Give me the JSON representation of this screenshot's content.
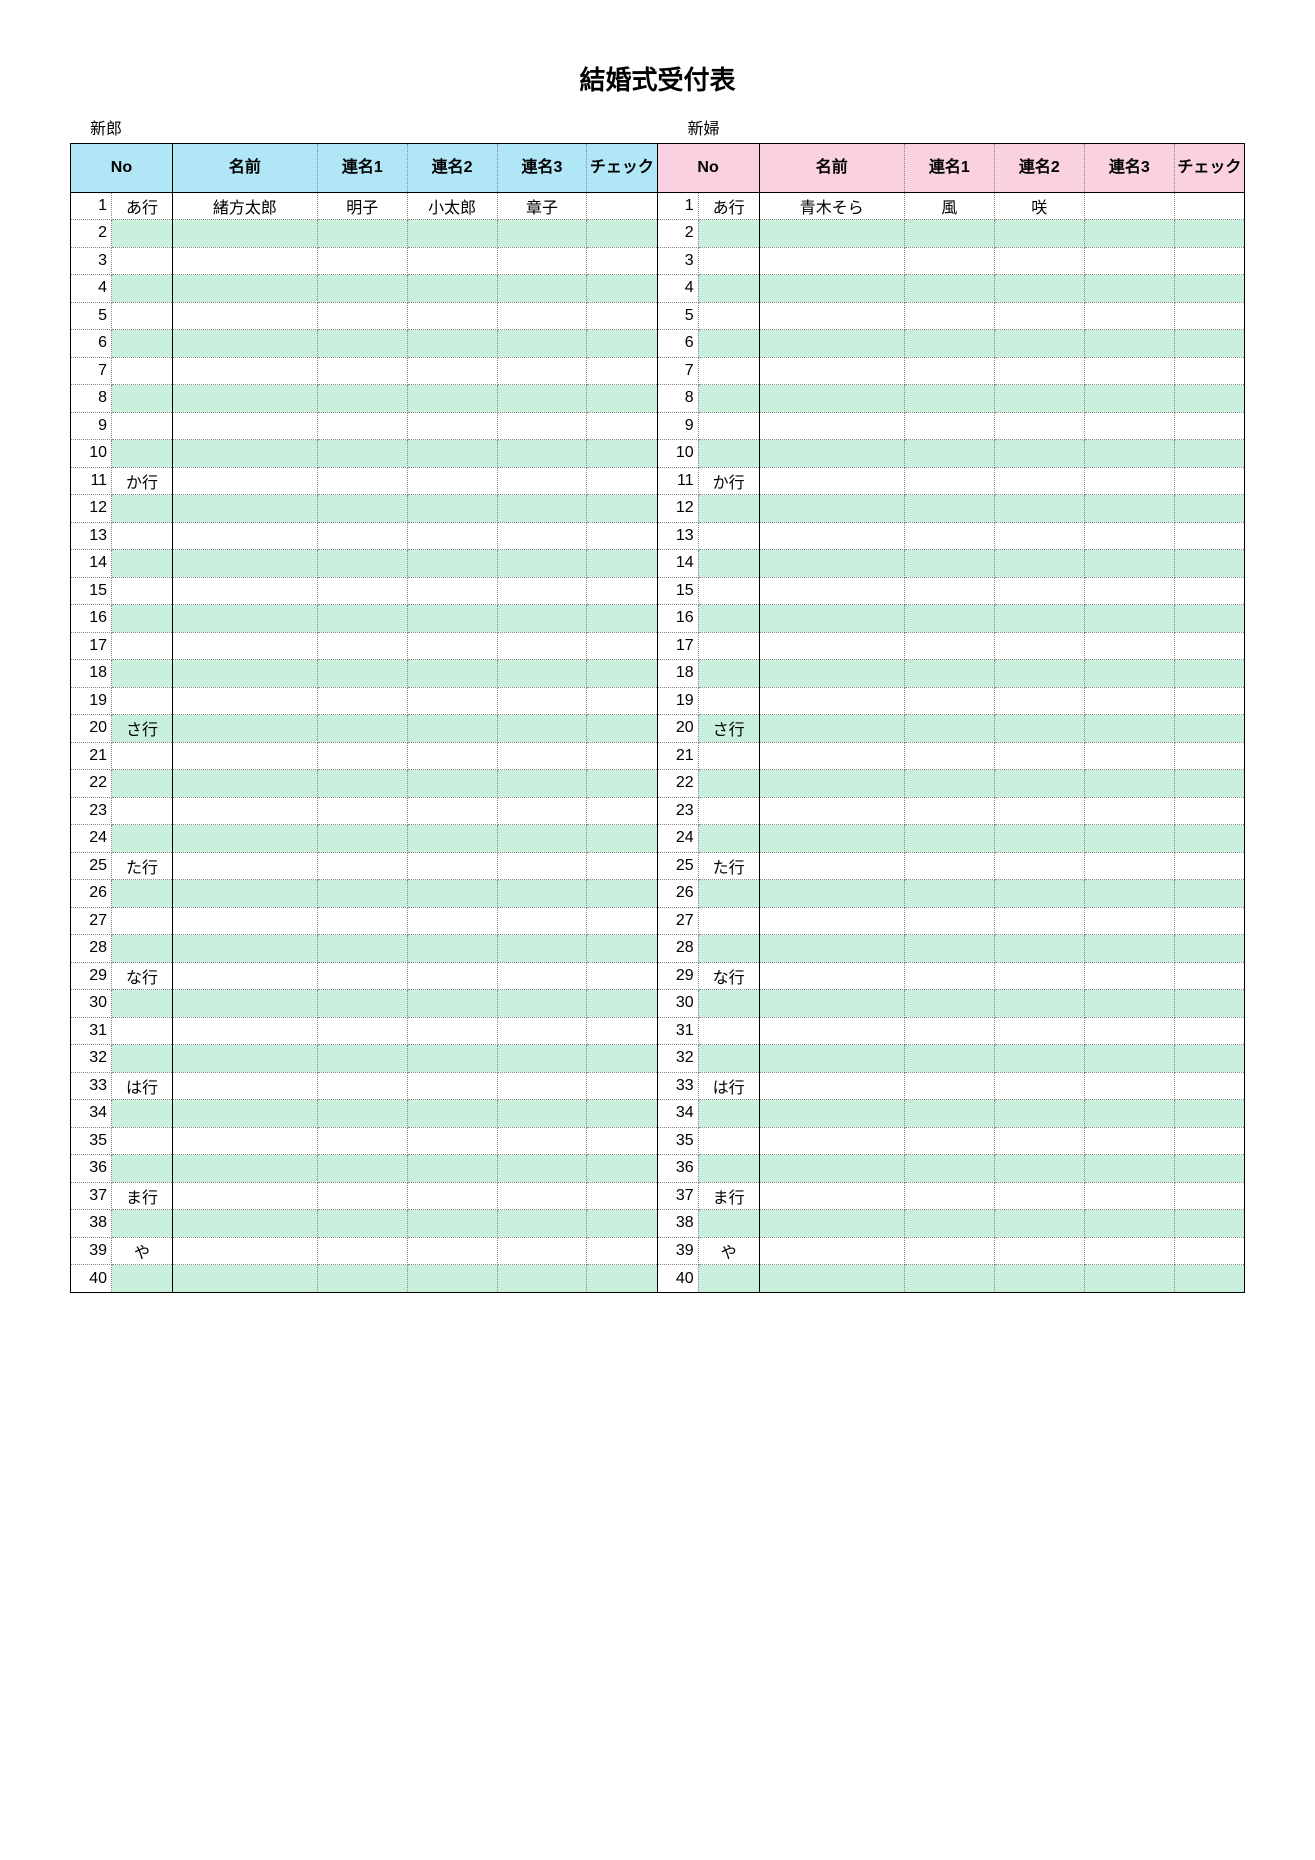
{
  "title": "結婚式受付表",
  "groom_label": "新郎",
  "bride_label": "新婦",
  "headers": {
    "no": "No",
    "name": "名前",
    "ren1": "連名1",
    "ren2": "連名2",
    "ren3": "連名3",
    "check": "チェック"
  },
  "kana_groups": [
    {
      "row": 1,
      "label": "あ行"
    },
    {
      "row": 11,
      "label": "か行"
    },
    {
      "row": 20,
      "label": "さ行"
    },
    {
      "row": 25,
      "label": "た行"
    },
    {
      "row": 29,
      "label": "な行"
    },
    {
      "row": 33,
      "label": "は行"
    },
    {
      "row": 37,
      "label": "ま行"
    },
    {
      "row": 39,
      "label": "や"
    }
  ],
  "row_count": 40,
  "groom_rows": [
    {
      "no": 1,
      "name": "緒方太郎",
      "ren1": "明子",
      "ren2": "小太郎",
      "ren3": "章子",
      "check": ""
    }
  ],
  "bride_rows": [
    {
      "no": 1,
      "name": "青木そら",
      "ren1": "風",
      "ren2": "咲",
      "ren3": "",
      "check": ""
    }
  ],
  "colors": {
    "groom_header": "#b0e6f6",
    "bride_header": "#fad1e0",
    "stripe": "#c8f0dd"
  }
}
